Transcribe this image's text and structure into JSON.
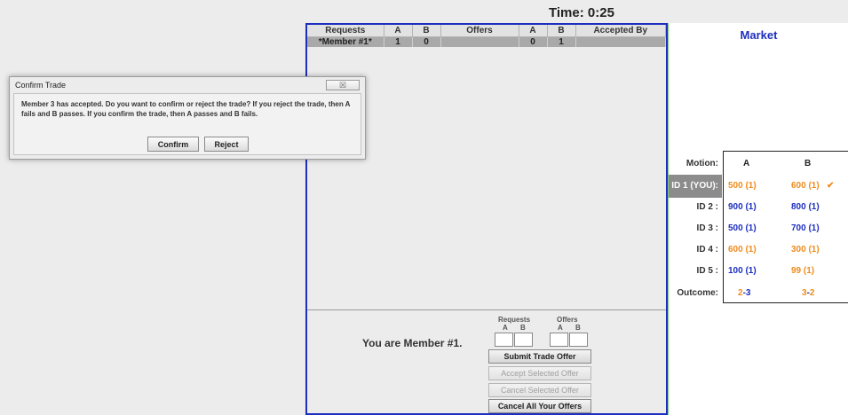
{
  "timer": "Time: 0:25",
  "trade_table": {
    "headers": [
      "Requests",
      "A",
      "B",
      "Offers",
      "A",
      "B",
      "Accepted By"
    ],
    "rows": [
      [
        "*Member #1*",
        "1",
        "0",
        "",
        "0",
        "1",
        ""
      ]
    ]
  },
  "trade_form": {
    "you_are": "You are Member #1.",
    "requests_label": "Requests",
    "offers_label": "Offers",
    "col_a": "A",
    "col_b": "B",
    "submit_label": "Submit Trade Offer",
    "accept_label": "Accept Selected Offer",
    "cancel_label": "Cancel Selected Offer",
    "cancel_all_label": "Cancel All Your Offers"
  },
  "market": {
    "title": "Market",
    "motion_label": "Motion:",
    "col_a": "A",
    "col_b": "B",
    "rows": [
      {
        "id": "ID 1 (YOU):",
        "a": "500 (1)",
        "b": "600 (1)",
        "check": "✔"
      },
      {
        "id": "ID 2 :",
        "a": "900 (1)",
        "b": "800 (1)"
      },
      {
        "id": "ID 3 :",
        "a": "500 (1)",
        "b": "700 (1)"
      },
      {
        "id": "ID 4 :",
        "a": "600 (1)",
        "b": "300 (1)"
      },
      {
        "id": "ID 5 :",
        "a": "100 (1)",
        "b": "99 (1)"
      }
    ],
    "outcome_label": "Outcome:",
    "outcome_a_left": "2",
    "outcome_a_sep": "-",
    "outcome_a_right": "3",
    "outcome_b_left": "3",
    "outcome_b_sep": "-",
    "outcome_b_right": "2",
    "colors": {
      "orange": "#f08c1e",
      "blue": "#1e2fbf"
    }
  },
  "dialog": {
    "title": "Confirm Trade",
    "close_glyph": "☒",
    "message": "Member 3 has accepted. Do you want to confirm or reject the trade? If you reject the trade, then A fails and B passes. If you confirm the trade, then A passes and B fails.",
    "confirm_label": "Confirm",
    "reject_label": "Reject"
  }
}
